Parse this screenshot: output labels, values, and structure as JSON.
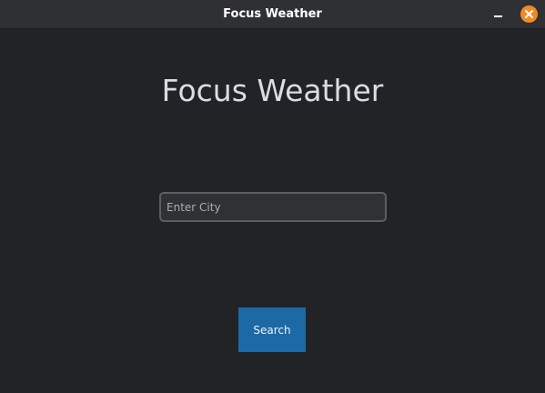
{
  "window": {
    "title": "Focus Weather"
  },
  "main": {
    "heading": "Focus Weather",
    "city_input": {
      "value": "",
      "placeholder": "Enter City"
    },
    "search_button": {
      "label": "Search"
    }
  },
  "colors": {
    "background": "#222326",
    "titlebar": "#2f3033",
    "close_button": "#f08a24",
    "search_button": "#1c6aa5",
    "heading_text": "#d8dde6"
  },
  "icons": {
    "minimize": "minimize-icon",
    "close": "close-icon"
  }
}
